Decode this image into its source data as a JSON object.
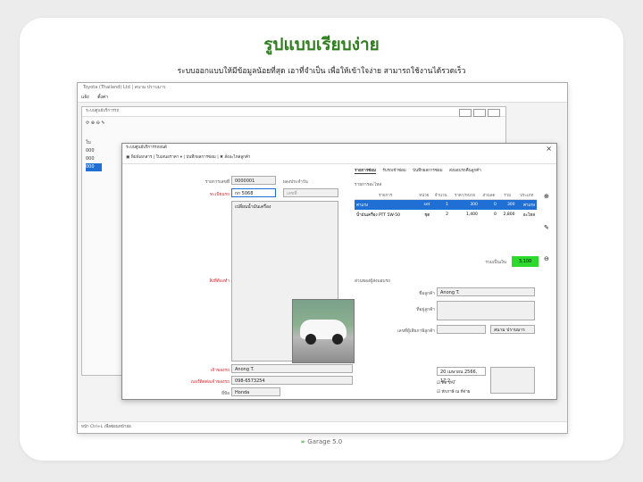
{
  "header": {
    "title": "รูปแบบเรียบง่าย",
    "subtitle": "ระบบออกแบบให้มีข้อมูลน้อยที่สุด เอาที่จำเป็น เพื่อให้เข้าใจง่าย สามารถใช้งานได้รวดเร็ว"
  },
  "app": {
    "window_title": "Toyota (Thailand) Ltd | สนาม ปราบมาร",
    "menu": [
      "แจ้ง",
      "ตั้งค่า"
    ],
    "inner_title": "ระบบศูนย์บริการรถ",
    "list_rows": [
      "ใบ",
      "000",
      "000",
      "000"
    ],
    "footer_hint": "หน้า Ctrl+L เพื่อซ่อนหน้าย่อ"
  },
  "dialog": {
    "title": "ระบบศูนย์บริการรถยนต์",
    "toolbar": [
      "พิมพ์เอกสาร",
      "ใบเสนอราคา",
      "บันทึกผลการซ่อม",
      "สั่งอะไหล่ลูกค้า"
    ],
    "close": "×",
    "form": {
      "job_no_label": "รายการเลขที่",
      "job_no": "0000001",
      "type_label": "ผลงประจำวัน",
      "type_value": "เลขที่",
      "plate_label": "ทะเบียนรถ",
      "plate": "กก 5068",
      "repair_label": "สิ่งที่ต้องทำ",
      "repair_text": "เปลี่ยนน้ำมันเครื่อง",
      "customer_label": "เจ้าของรถ",
      "customer": "Anong T.",
      "phone_label": "เบอร์ติดต่อเจ้าของรถ",
      "phone": "098-6573254",
      "brand_label": "ยี่ห้อ",
      "brand": "Honda",
      "model_label": "รุ่น",
      "model": "City",
      "color_label": "สี",
      "color": "เงิน",
      "date_label": "วันที่รับงาน",
      "date": "20 Apr 2023, 09:31",
      "status_label": "สถานะ",
      "status": "รับรถเข้าซ่อม"
    },
    "tabs": [
      "รายการซ่อม",
      "รับรถเข้าซ่อม",
      "บันทึกผลการซ่อม",
      "ส่งมอบรถคืนลูกค้า"
    ],
    "parts_caption": "รายการอะไหล่",
    "parts_headers": [
      "รายการ",
      "หน่วย",
      "จำนวน",
      "ราคา/หน่วย",
      "ส่วนลด",
      "รวม",
      "ประเภท"
    ],
    "parts": [
      {
        "name": "ค่าแรง",
        "unit": "set",
        "qty": "1",
        "price": "300",
        "disc": "0",
        "total": "300",
        "type": "ค่าแรง"
      },
      {
        "name": "น้ำมันเครื่อง PTT 5W-50",
        "unit": "ชุด",
        "qty": "2",
        "price": "1,400",
        "disc": "0",
        "total": "2,800",
        "type": "อะไหล่"
      }
    ],
    "total_label": "รวมเป็นเงิน",
    "total": "3,100",
    "owner_section": "ส่วนของผู้ส่งมอบรถ",
    "owner_name_label": "ชื่อลูกค้า",
    "owner_name": "Anong T.",
    "address_label": "ที่อยู่ลูกค้า",
    "tax_label": "เลขที่ผู้เสียภาษีลูกค้า",
    "contact_label": "ผู้ติดต่อ",
    "contact": "สนาม ปราบมาร",
    "note_label": "หมายเหตุ",
    "date2": "20 เมษายน 2566, 17:2",
    "vat": "คิด VAT",
    "withholding": "หักภาษี ณ ที่จ่าย"
  },
  "brand": "Garage 5.0"
}
